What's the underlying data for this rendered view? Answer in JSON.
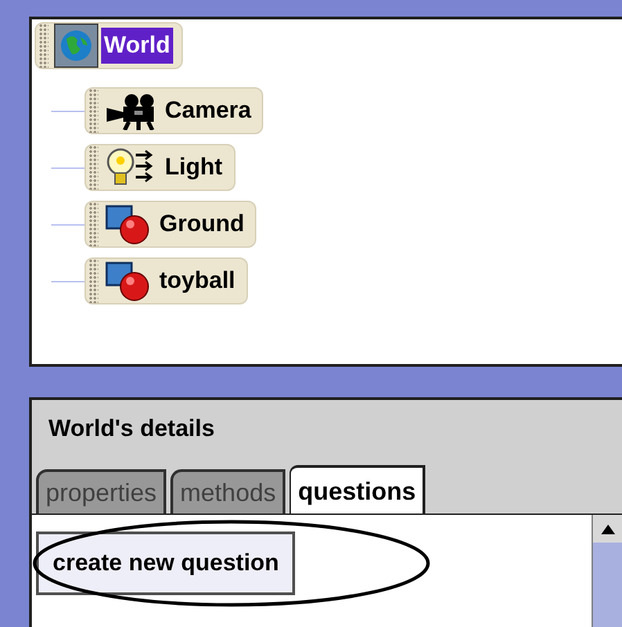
{
  "object_tree": {
    "label": "World",
    "kind": "world",
    "selected": true,
    "children": [
      {
        "label": "Camera",
        "kind": "camera",
        "selected": false
      },
      {
        "label": "Light",
        "kind": "light",
        "selected": false
      },
      {
        "label": "Ground",
        "kind": "object",
        "selected": false
      },
      {
        "label": "toyball",
        "kind": "object",
        "selected": false
      }
    ]
  },
  "details": {
    "title": "World's details",
    "tabs": [
      {
        "label": "properties",
        "selected": false
      },
      {
        "label": "methods",
        "selected": false
      },
      {
        "label": "questions",
        "selected": true
      }
    ],
    "button": {
      "label": "create new question",
      "circled": true
    }
  }
}
